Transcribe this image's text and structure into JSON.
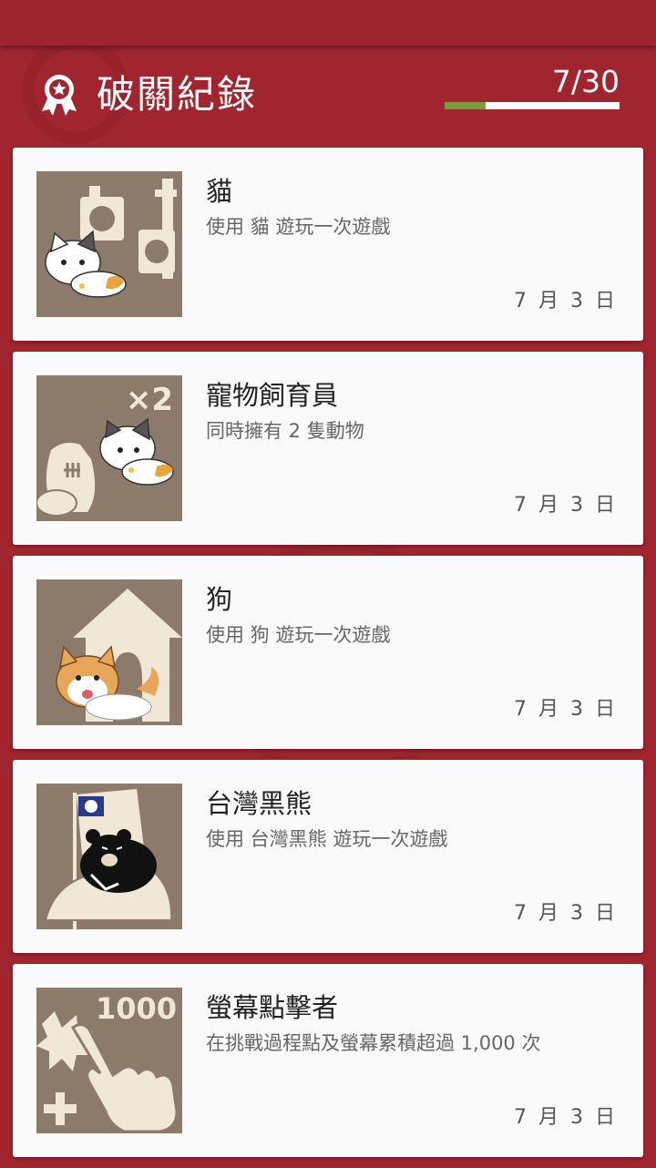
{
  "header": {
    "title": "破關紀錄",
    "counter": "7/30",
    "progress_fraction": 0.233,
    "icon": "award-ribbon-icon"
  },
  "colors": {
    "background": "#a1252f",
    "card": "#fafafa",
    "thumb_bg": "#8c7b6b",
    "progress_fill": "#7a9a3d"
  },
  "achievements": [
    {
      "title": "貓",
      "desc": "使用 貓 遊玩一次遊戲",
      "date": "7 月 3 日",
      "icon": "cat-icon"
    },
    {
      "title": "寵物飼育員",
      "desc": "同時擁有 2 隻動物",
      "date": "7 月 3 日",
      "icon": "pet-x2-icon"
    },
    {
      "title": "狗",
      "desc": "使用 狗 遊玩一次遊戲",
      "date": "7 月 3 日",
      "icon": "dog-icon"
    },
    {
      "title": "台灣黑熊",
      "desc": "使用 台灣黑熊 遊玩一次遊戲",
      "date": "7 月 3 日",
      "icon": "black-bear-icon"
    },
    {
      "title": "螢幕點擊者",
      "desc": "在挑戰過程點及螢幕累積超過 1,000 次",
      "date": "7 月 3 日",
      "icon": "tap-1000-icon"
    }
  ],
  "thumb_labels": {
    "pet": "×2",
    "tap": "1000"
  }
}
